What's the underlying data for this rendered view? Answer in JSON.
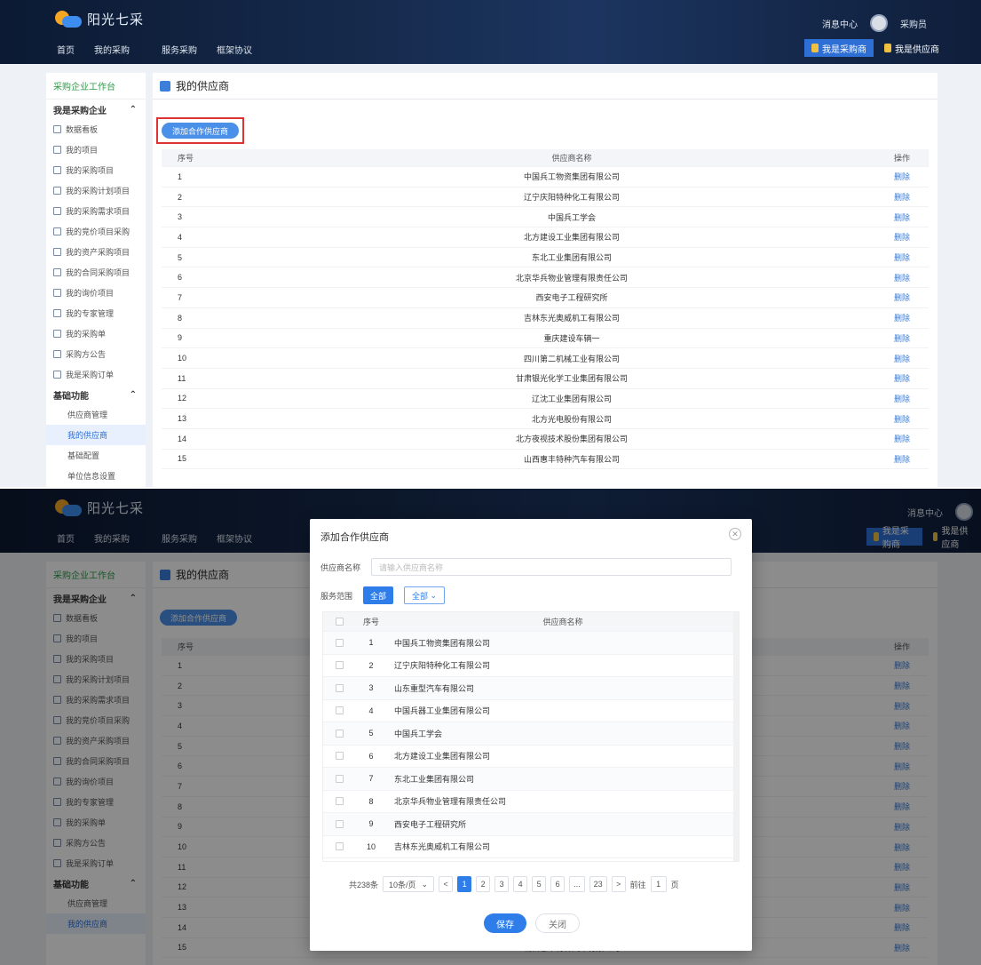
{
  "header": {
    "logo_text": "阳光七采",
    "nav": [
      "首页",
      "我的采购",
      "服务采购",
      "框架协议"
    ],
    "message_center": "消息中心",
    "username": "采购员",
    "roles": [
      "我是采购商",
      "我是供应商"
    ]
  },
  "sidebar": {
    "workspace": "采购企业工作台",
    "group1": "我是采购企业",
    "items": [
      "数据看板",
      "我的项目",
      "我的采购项目",
      "我的采购计划项目",
      "我的采购需求项目",
      "我的竞价项目采购",
      "我的资产采购项目",
      "我的合同采购项目",
      "我的询价项目",
      "我的专家管理",
      "我的采购单",
      "采购方公告",
      "我是采购订单"
    ],
    "group2": "基础功能",
    "subs": [
      "供应商管理",
      "我的供应商",
      "基础配置",
      "单位信息设置"
    ]
  },
  "content": {
    "page_title": "我的供应商",
    "add_button": "添加合作供应商",
    "col_no": "序号",
    "col_name": "供应商名称",
    "col_op": "操作",
    "op_label": "删除",
    "rows": [
      {
        "no": "1",
        "name": "中国兵工物资集团有限公司"
      },
      {
        "no": "2",
        "name": "辽宁庆阳特种化工有限公司"
      },
      {
        "no": "3",
        "name": "中国兵工学会"
      },
      {
        "no": "4",
        "name": "北方建设工业集团有限公司"
      },
      {
        "no": "5",
        "name": "东北工业集团有限公司"
      },
      {
        "no": "6",
        "name": "北京华兵物业管理有限责任公司"
      },
      {
        "no": "7",
        "name": "西安电子工程研究所"
      },
      {
        "no": "8",
        "name": "吉林东光奥威机工有限公司"
      },
      {
        "no": "9",
        "name": "重庆建设车辆一"
      },
      {
        "no": "10",
        "name": "四川第二机械工业有限公司"
      },
      {
        "no": "11",
        "name": "甘肃银光化学工业集团有限公司"
      },
      {
        "no": "12",
        "name": "辽沈工业集团有限公司"
      },
      {
        "no": "13",
        "name": "北方光电股份有限公司"
      },
      {
        "no": "14",
        "name": "北方夜视技术股份集团有限公司"
      },
      {
        "no": "15",
        "name": "山西惠丰特种汽车有限公司"
      }
    ]
  },
  "modal": {
    "title": "添加合作供应商",
    "name_label": "供应商名称",
    "name_placeholder": "请输入供应商名称",
    "scope_label": "服务范围",
    "scope_all": "全部",
    "scope_select": "全部",
    "col_no": "序号",
    "col_name": "供应商名称",
    "rows": [
      {
        "no": "1",
        "name": "中国兵工物资集团有限公司"
      },
      {
        "no": "2",
        "name": "辽宁庆阳特种化工有限公司"
      },
      {
        "no": "3",
        "name": "山东重型汽车有限公司"
      },
      {
        "no": "4",
        "name": "中国兵器工业集团有限公司"
      },
      {
        "no": "5",
        "name": "中国兵工学会"
      },
      {
        "no": "6",
        "name": "北方建设工业集团有限公司"
      },
      {
        "no": "7",
        "name": "东北工业集团有限公司"
      },
      {
        "no": "8",
        "name": "北京华兵物业管理有限责任公司"
      },
      {
        "no": "9",
        "name": "西安电子工程研究所"
      },
      {
        "no": "10",
        "name": "吉林东光奥威机工有限公司"
      }
    ],
    "total_text": "共238条",
    "page_size": "10条/页",
    "pages": [
      "1",
      "2",
      "3",
      "4",
      "5",
      "6",
      "...",
      "23"
    ],
    "current_page": "1",
    "goto_label": "前往",
    "goto_value": "1",
    "goto_suffix": "页",
    "save": "保存",
    "cancel": "关闭"
  }
}
